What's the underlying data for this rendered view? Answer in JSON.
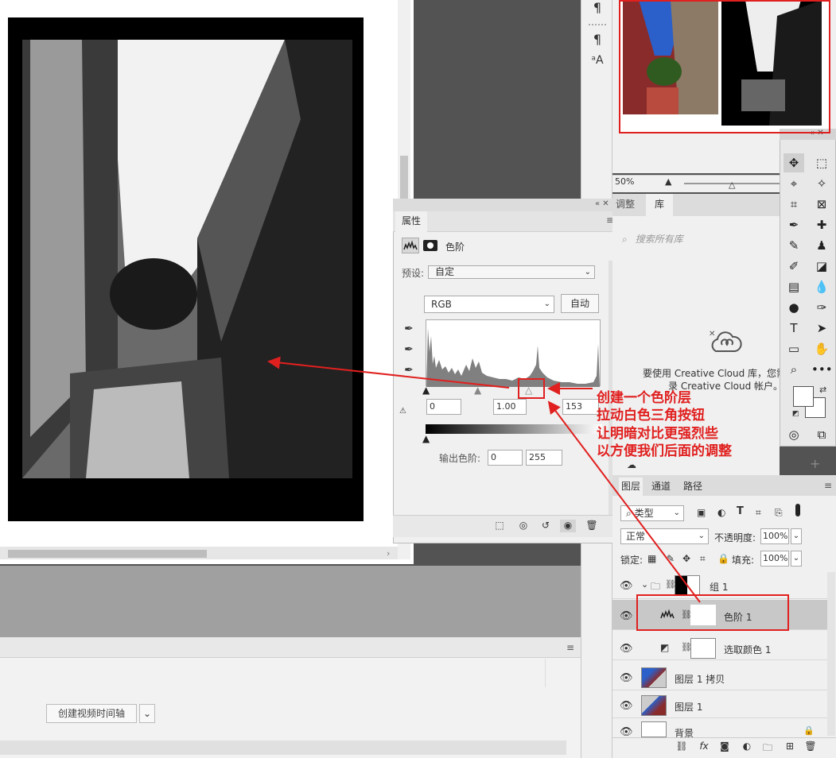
{
  "narrow_column": {
    "icons": [
      "paragraph-icon",
      "paragraph-style-icon",
      "character-style-icon"
    ],
    "glyphs": [
      "¶",
      "¶",
      "ᵃA"
    ]
  },
  "properties": {
    "tab": "属性",
    "adjustment_title": "色阶",
    "preset_label": "预设:",
    "preset_value": "自定",
    "channel": "RGB",
    "auto_button": "自动",
    "input_black": "0",
    "input_gamma": "1.00",
    "input_white": "153",
    "output_label": "输出色阶:",
    "output_black": "0",
    "output_white": "255"
  },
  "navigator": {
    "zoom": "50%"
  },
  "library": {
    "tab_adjust": "调整",
    "tab_library": "库",
    "search_placeholder": "搜索所有库",
    "message_line1": "要使用 Creative Cloud 库，您需",
    "message_line2": "录 Creative Cloud 帐户。"
  },
  "timeline": {
    "create_button": "创建视频时间轴"
  },
  "layers": {
    "tabs": [
      "图层",
      "通道",
      "路径"
    ],
    "filter": "类型",
    "blend_mode": "正常",
    "opacity_label": "不透明度:",
    "opacity": "100%",
    "lock_label": "锁定:",
    "fill_label": "填充:",
    "fill": "100%",
    "items": [
      {
        "name": "组 1"
      },
      {
        "name": "色阶 1"
      },
      {
        "name": "选取颜色 1"
      },
      {
        "name": "图层 1 拷贝"
      },
      {
        "name": "图层 1"
      },
      {
        "name": "背景"
      }
    ]
  },
  "annotation": {
    "lines": [
      "创建一个色阶层",
      "拉动白色三角按钮",
      "让明暗对比更强烈些",
      "以方便我们后面的调整"
    ],
    "color": "#e0201f"
  },
  "histogram_gray": "#808080"
}
